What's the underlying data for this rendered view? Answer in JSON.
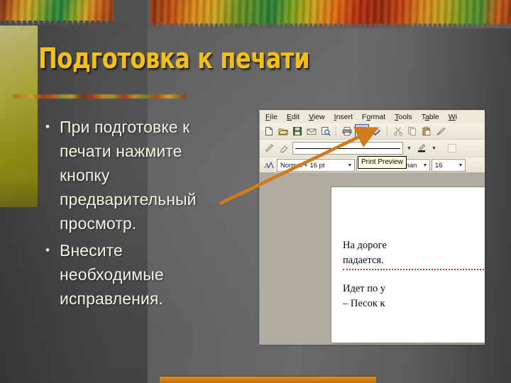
{
  "slide": {
    "title": "Подготовка к печати",
    "bullet_marker": "•",
    "bullets": [
      "При подготовке к печати нажмите кнопку предварительный просмотр.",
      "Внесите необходимые исправления."
    ]
  },
  "colors": {
    "title_text": "#f5c016",
    "body_text": "#f4f2e0",
    "slide_background": "#5e5e5e",
    "left_panel_olive": "#8d8a14",
    "bottom_bar_orange": "#d4800f",
    "arrow_orange": "#d07a1a",
    "word_chrome": "#ece9d8",
    "word_workspace": "#b0ada0",
    "selected_button_fill": "#c3d4ec",
    "selected_button_border": "#2b5797",
    "spelling_error_underline": "#c23b3b"
  },
  "word": {
    "menu": [
      {
        "label": "File",
        "accel": "F"
      },
      {
        "label": "Edit",
        "accel": "E"
      },
      {
        "label": "View",
        "accel": "V"
      },
      {
        "label": "Insert",
        "accel": "I"
      },
      {
        "label": "Format",
        "accel": "o"
      },
      {
        "label": "Tools",
        "accel": "T"
      },
      {
        "label": "Table",
        "accel": "a"
      },
      {
        "label": "Wi",
        "accel": "W"
      }
    ],
    "standard_toolbar": [
      {
        "name": "new-document-icon",
        "title": "New"
      },
      {
        "name": "open-folder-icon",
        "title": "Open"
      },
      {
        "name": "save-icon",
        "title": "Save"
      },
      {
        "name": "mail-icon",
        "title": "E-mail"
      },
      {
        "name": "search-document-icon",
        "title": "Search"
      },
      {
        "name": "print-icon",
        "title": "Print"
      },
      {
        "name": "print-preview-icon",
        "title": "Print Preview"
      },
      {
        "name": "spelling-check-icon",
        "title": "Spelling and Grammar"
      },
      {
        "name": "cut-scissors-icon",
        "title": "Cut"
      },
      {
        "name": "copy-icon",
        "title": "Copy"
      },
      {
        "name": "paste-icon",
        "title": "Paste"
      },
      {
        "name": "format-painter-icon",
        "title": "Format Painter"
      }
    ],
    "selected_button": "print-preview-icon",
    "tooltip": "Print Preview",
    "drawing_toolbar": [
      {
        "name": "pen-icon",
        "title": "Pen"
      },
      {
        "name": "eraser-icon",
        "title": "Eraser"
      }
    ],
    "line_style_value": "",
    "highlight_icon": "highlight-color-icon",
    "table-grid_icon": "table-grid-icon",
    "formatting_bar": {
      "style_icon": "style-icon",
      "style_value": "Normal + 16 pt",
      "font_value": "Times New Roman",
      "size_value": "16"
    },
    "document_lines": [
      {
        "text": "На дороге",
        "error": false
      },
      {
        "text": "падается.",
        "error": true
      },
      {
        "text": "",
        "error": false
      },
      {
        "text": "Идет по у",
        "error": false
      },
      {
        "text": "– Песок к",
        "error": false
      }
    ]
  }
}
